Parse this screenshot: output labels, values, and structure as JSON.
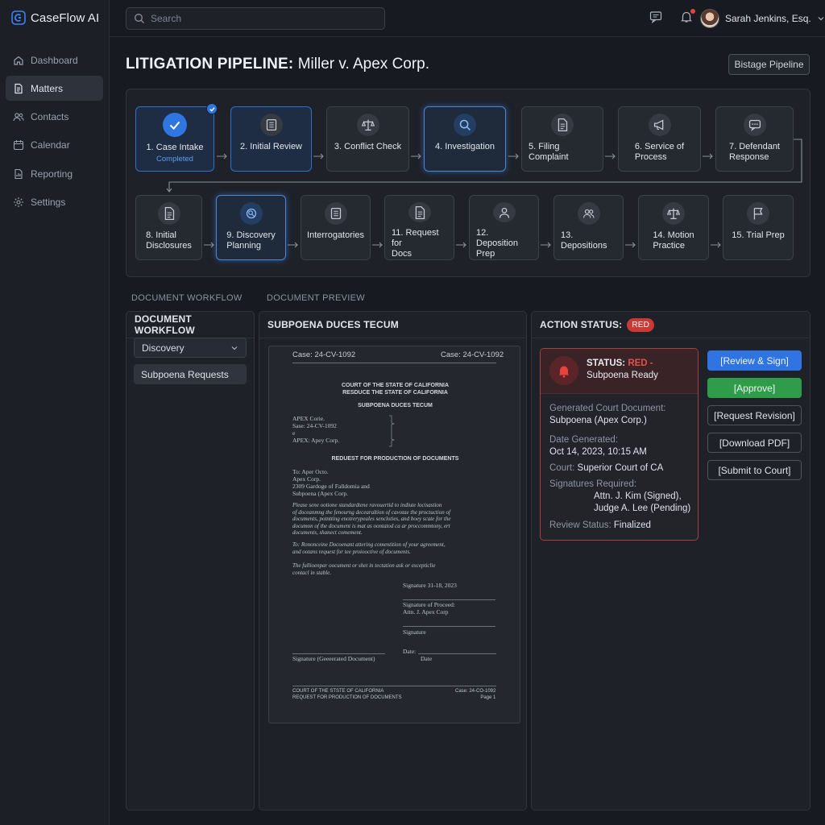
{
  "app": {
    "name": "CaseFlow AI"
  },
  "sidebar": {
    "items": [
      {
        "label": "Dashboard",
        "icon": "home-icon"
      },
      {
        "label": "Matters",
        "icon": "document-icon",
        "active": true
      },
      {
        "label": "Contacts",
        "icon": "users-icon"
      },
      {
        "label": "Calendar",
        "icon": "calendar-icon"
      },
      {
        "label": "Reporting",
        "icon": "report-icon"
      },
      {
        "label": "Settings",
        "icon": "gear-icon"
      }
    ]
  },
  "topbar": {
    "search_placeholder": "Search",
    "user_name": "Sarah Jenkins, Esq."
  },
  "page": {
    "title_bold": "LITIGATION PIPELINE:",
    "title_rest": "Miller v. Apex Corp.",
    "pipeline_button": "Bistage Pipeline"
  },
  "pipeline": {
    "stages": [
      {
        "label": "1. Case Intake",
        "sub": "Completed",
        "icon": "check-icon",
        "state": "done"
      },
      {
        "label": "2. Initial Review",
        "icon": "list-icon",
        "state": "done"
      },
      {
        "label": "3. Conflict Check",
        "icon": "scales-icon",
        "state": "normal"
      },
      {
        "label": "4. Investigation",
        "icon": "search-icon",
        "state": "active"
      },
      {
        "label": "5. Filing Complaint",
        "icon": "file-icon",
        "state": "normal"
      },
      {
        "label": "6. Service of\nProcess",
        "icon": "megaphone-icon",
        "state": "normal"
      },
      {
        "label": "7. Defendant\nResponse",
        "icon": "chat-icon",
        "state": "normal"
      },
      {
        "label": "8. Initial\nDisclosures",
        "icon": "file-icon",
        "state": "normal"
      },
      {
        "label": "9. Discovery\nPlanning",
        "icon": "discovery-icon",
        "state": "active"
      },
      {
        "label": "Interrogatories",
        "icon": "list-icon",
        "state": "normal"
      },
      {
        "label": "11. Request for\nDocs",
        "icon": "file-icon",
        "state": "normal"
      },
      {
        "label": "12. Deposition\nPrep",
        "icon": "person-icon",
        "state": "normal"
      },
      {
        "label": "13. Depositions",
        "icon": "users-icon",
        "state": "normal"
      },
      {
        "label": "14. Motion\nPractice",
        "icon": "scales-icon",
        "state": "normal"
      },
      {
        "label": "15. Trial Prep",
        "icon": "flag-icon",
        "state": "normal"
      }
    ]
  },
  "sections": {
    "workflow_label": "DOCUMENT WORKFLOW",
    "preview_label": "DOCUMENT PREVIEW"
  },
  "workflow": {
    "header": "DOCUMENT WORKFLOW",
    "select_value": "Discovery",
    "items": [
      "Subpoena Requests"
    ]
  },
  "preview": {
    "header": "SUBPOENA DUCES TECUM",
    "doc": {
      "case_left": "Case: 24-CV-1092",
      "case_right": "Case: 24-CV-1092",
      "court1": "COURT OF THE STATE OF CALIFORNIA",
      "court2": "RESDUCE THE STATE OF CALIFORNIA",
      "title": "SUBPOENA DUCES TECUM",
      "parties": "APEX Corie.\n    Sase: 24-CV-1092\n    e\nAPEX: Apey Corp.",
      "request_title": "REDUEST FOR PRODUCTION OF DOCUMENTS",
      "to": "To:   Aper Octo.\n         Apex Corp.\n         2309 Gardoge of Falldomia and\n         Subpoena (Apex Corp.",
      "para1": "Please sene ootione standardtene ravouertid to indiute locisastion\nof doceanmng the fenourng decearaltion of cavotae the proctuction of\ndocuments, potntting enotrerypeales sencloties, and boey scate for the\ndocumon of the document is mat as oontatod ca ar proccommtony, ert\ndocuments, shanect comement.",
      "para2": "To: Rononceine Docoenant attering comentition of your agreement,\nand ootans request for tee proiooctive of documents.",
      "para3": "The fullioenpar oocument or shet in tectation ask or excepticlie\ncontacl in stable.",
      "sig_date": "Signature 31-18, 2023",
      "sig_proceed": "Signature of Proceed:\nAttn. J. Apex Corp",
      "sig_label": "Signature",
      "date_label": "Date:",
      "sig_generated": "Signature (Geeeerated Document)",
      "date2": "Date",
      "footer_left": "COURT OF THE STSTE OF CALIFORNIA\nREQUEST FOR PRODUCTION OF DOCUMENTS",
      "footer_right": "Case: 24-CO-1092\nPage 1"
    }
  },
  "action": {
    "header": "ACTION STATUS:",
    "pill": "RED",
    "status_prefix": "STATUS:",
    "status_red": "RED -",
    "status_text": "Subpoena Ready",
    "fields": {
      "doc_label": "Generated Court Document:",
      "doc_value": "Subpoena (Apex Corp.)",
      "date_label": "Date Generated:",
      "date_value": "Oct 14, 2023, 10:15 AM",
      "court_label": "Court:",
      "court_value": "Superior Court of CA",
      "sig_label": "Signatures Required:",
      "sig1": "Attn. J. Kim (Signed),",
      "sig2": "Judge A. Lee (Pending)",
      "review_label": "Review Status:",
      "review_value": "Finalized"
    },
    "buttons": [
      "[Review & Sign]",
      "[Approve]",
      "[Request Revision]",
      "[Download PDF]",
      "[Submit to Court]"
    ]
  },
  "colors": {
    "accent": "#2f74e0",
    "success": "#2f9c4a",
    "danger": "#c93a34",
    "background": "#171a21"
  }
}
